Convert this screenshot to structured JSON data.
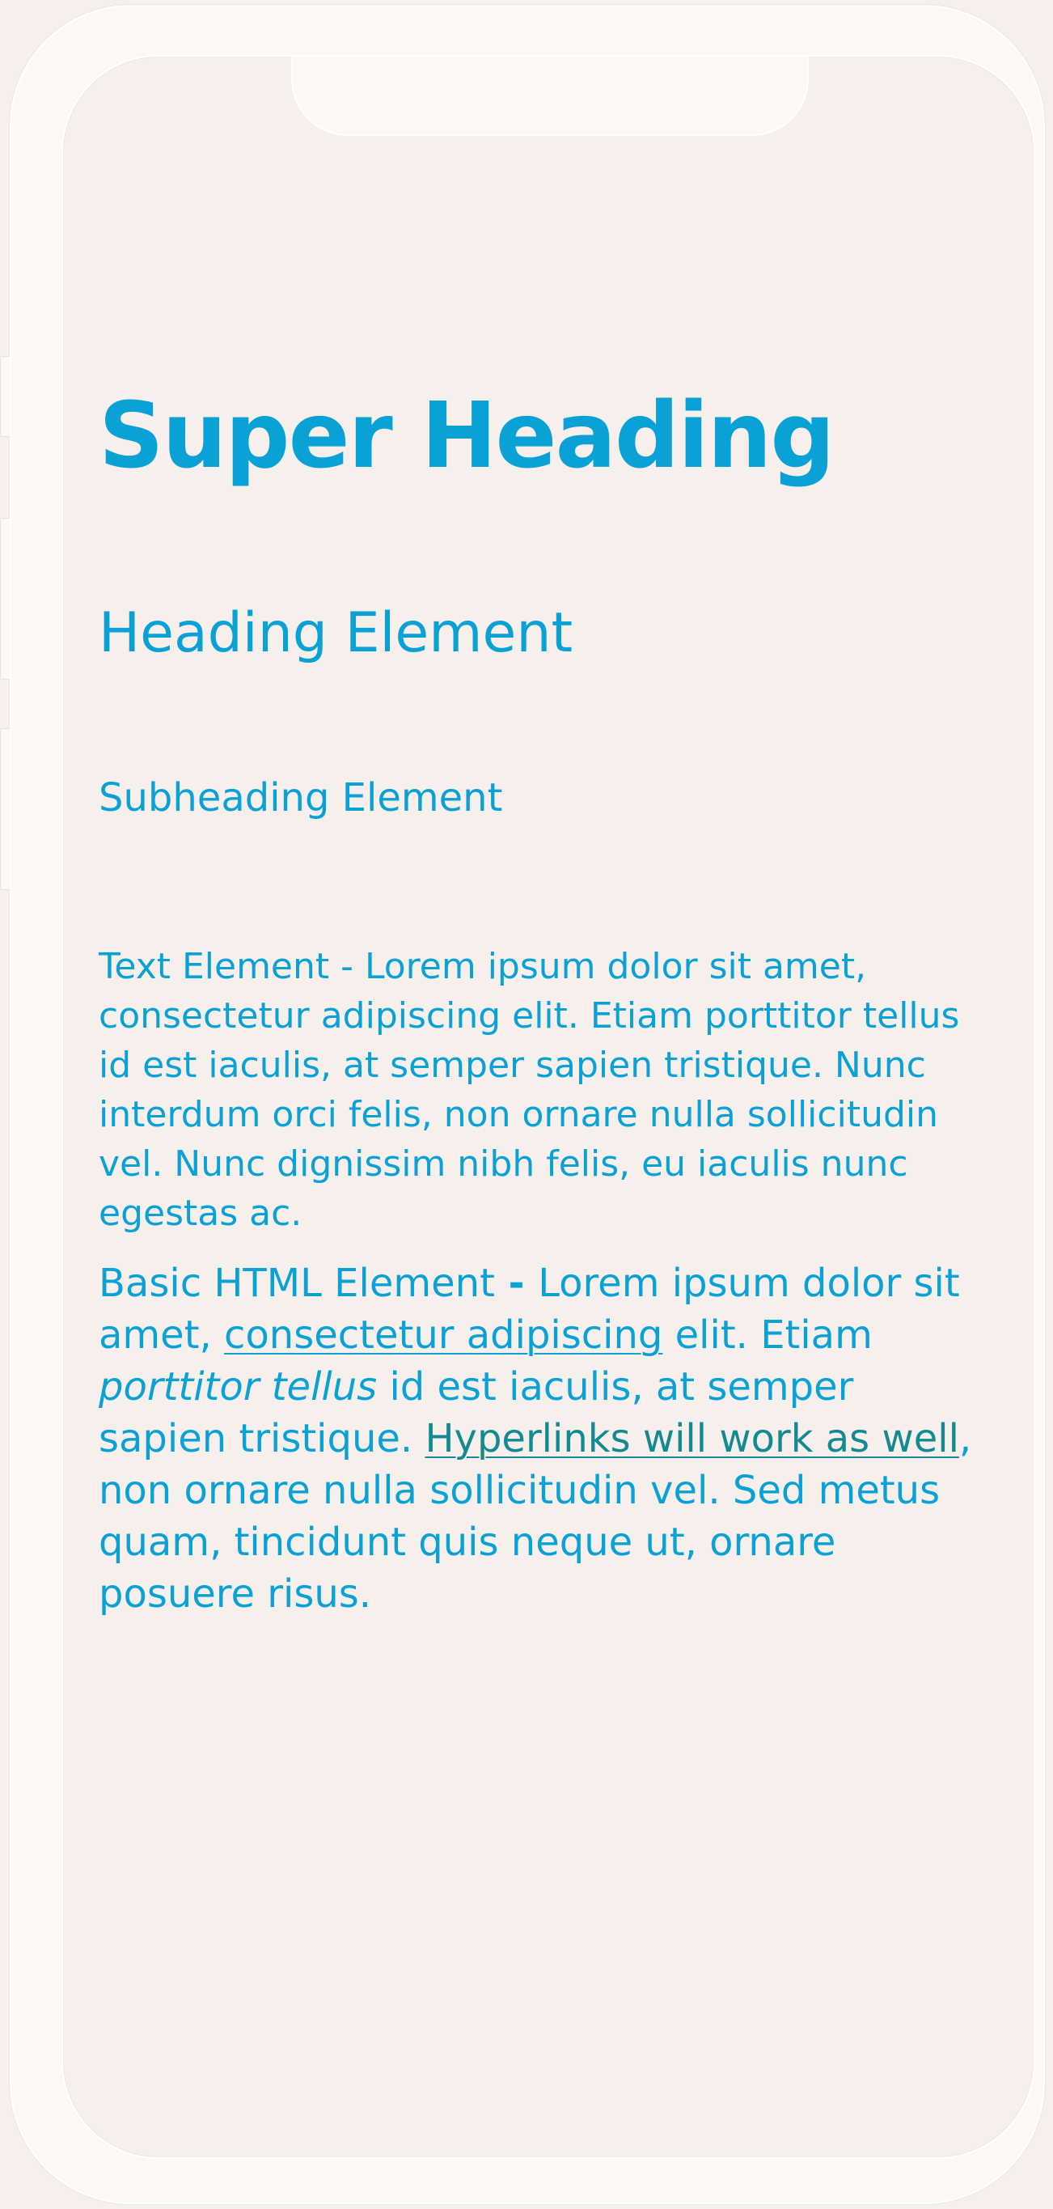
{
  "page": {
    "super_heading": "Super Heading",
    "heading": "Heading Element",
    "subheading": "Subheading Element",
    "text_element": "Text Element - Lorem ipsum dolor sit amet, consectetur adipiscing elit. Etiam porttitor tellus id est iaculis, at semper sapien tristique. Nunc interdum orci felis, non ornare nulla sollicitudin vel. Nunc dignissim nibh felis, eu iaculis nunc egestas ac.",
    "basic_html": {
      "label": "Basic HTML Element",
      "dash": " - ",
      "part1": "Lorem ipsum dolor sit amet, ",
      "link1": "consectetur adipiscing",
      "part2": " elit. Etiam ",
      "italic": "porttitor tellus",
      "part3": " id est iaculis, at semper sapien tristique. ",
      "link2": "Hyperlinks will work as well",
      "part4": ", non ornare nulla sollicitudin vel. Sed metus quam, tincidunt quis neque ut, ornare posuere risus."
    }
  },
  "colors": {
    "text": "#0aa2d6",
    "link": "#138a92",
    "background": "#f7efeb",
    "frame": "#fbf8f5"
  }
}
